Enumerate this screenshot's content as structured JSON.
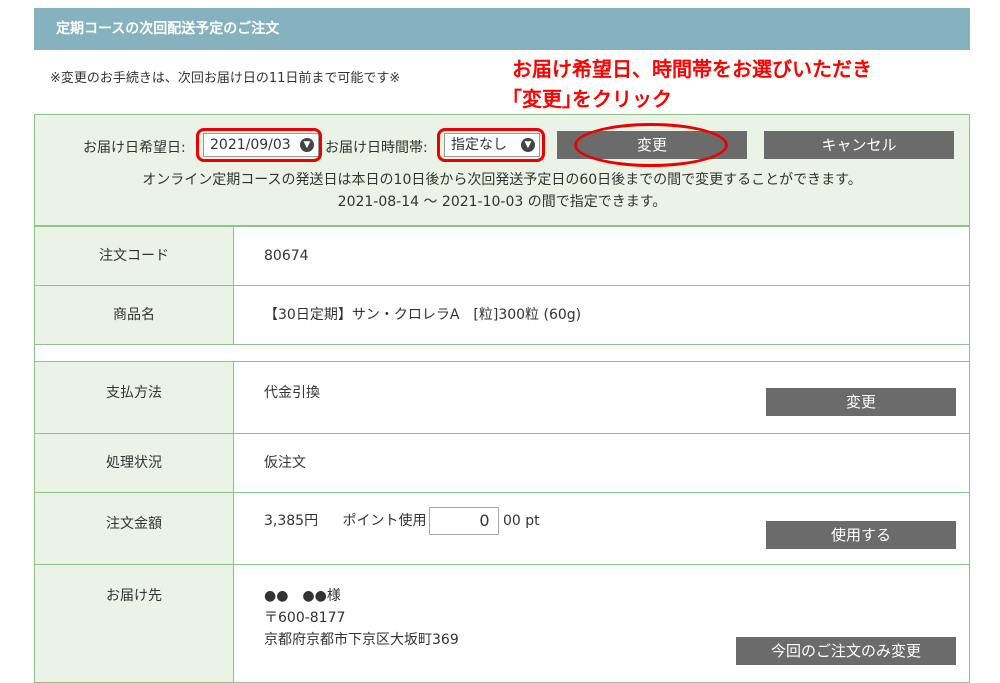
{
  "header": {
    "title": "定期コースの次回配送予定のご注文"
  },
  "notice": "※変更のお手続きは、次回お届け日の11日前まで可能です※",
  "annotation": {
    "line1": "お届け希望日、時間帯をお選びいただき",
    "line2": "｢変更｣をクリック"
  },
  "delivery": {
    "date_label": "お届け日希望日:",
    "date_value": "2021/09/03",
    "time_label": "お届け日時間帯:",
    "time_value": "指定なし",
    "change_button": "変更",
    "cancel_button": "キャンセル",
    "note1": "オンライン定期コースの発送日は本日の10日後から次回発送予定日の60日後までの間で変更することができます。",
    "note2": "2021-08-14 ～ 2021-10-03 の間で指定できます。"
  },
  "rows": {
    "order_code": {
      "label": "注文コード",
      "value": "80674"
    },
    "product": {
      "label": "商品名",
      "value": "【30日定期】サン・クロレラA　[粒]300粒 (60g)"
    },
    "payment": {
      "label": "支払方法",
      "value": "代金引換",
      "button": "変更"
    },
    "status": {
      "label": "処理状況",
      "value": "仮注文"
    },
    "amount": {
      "label": "注文金額",
      "value": "3,385円",
      "points_label": "ポイント使用",
      "points_value": "0",
      "points_unit": "00 pt",
      "button": "使用する"
    },
    "ship_to": {
      "label": "お届け先",
      "name": "●●　●●様",
      "postal": "〒600-8177",
      "address": "京都府京都市下京区大坂町369",
      "button": "今回のご注文のみ変更"
    }
  },
  "colors": {
    "header_bg": "#86b2c0",
    "panel_bg": "#eaf3e5",
    "border": "#8cc48c",
    "button": "#6b6b6b",
    "annotation": "#ff0000"
  }
}
